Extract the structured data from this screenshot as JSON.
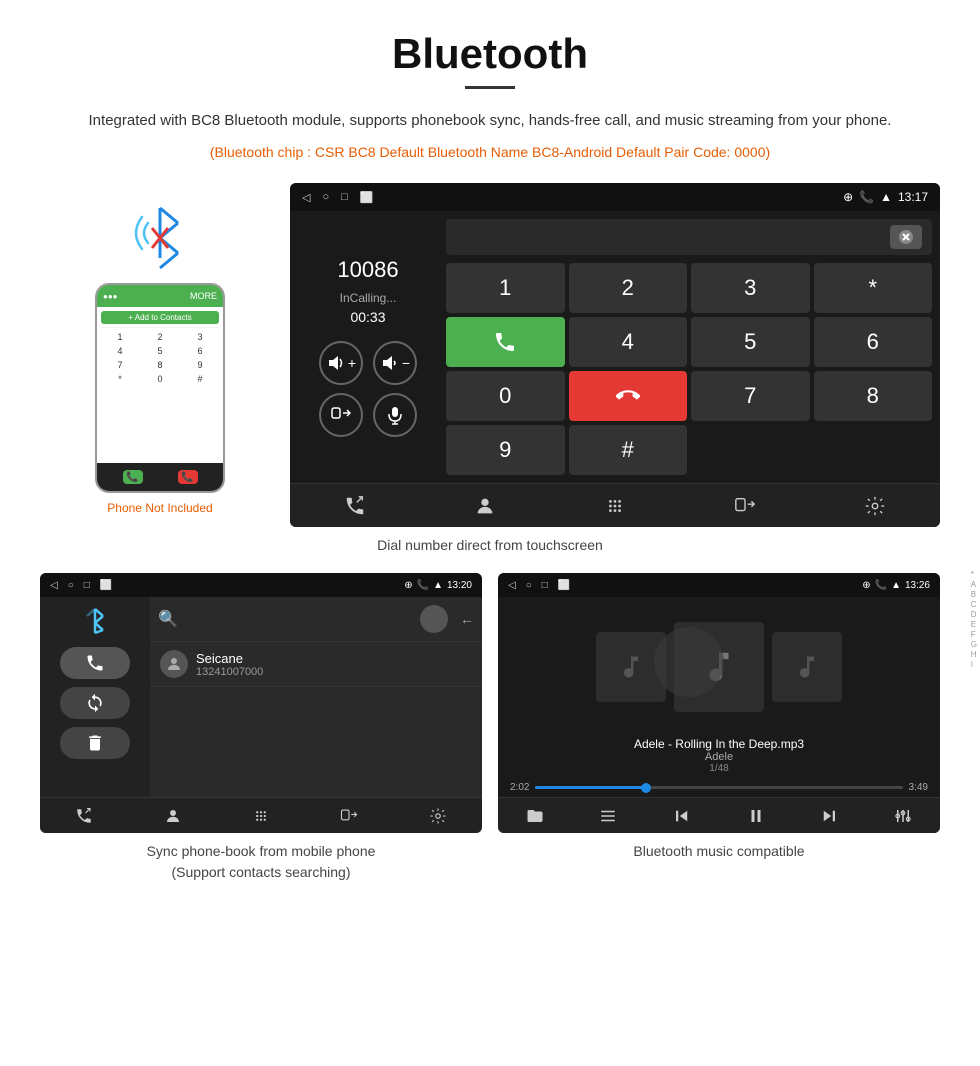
{
  "page": {
    "title": "Bluetooth",
    "description": "Integrated with BC8 Bluetooth module, supports phonebook sync, hands-free call, and music streaming from your phone.",
    "specs": "(Bluetooth chip : CSR BC8    Default Bluetooth Name BC8-Android    Default Pair Code: 0000)",
    "phone_not_included": "Phone Not Included",
    "dial_caption": "Dial number direct from touchscreen",
    "phonebook_caption_line1": "Sync phone-book from mobile phone",
    "phonebook_caption_line2": "(Support contacts searching)",
    "music_caption": "Bluetooth music compatible"
  },
  "dialer": {
    "number": "10086",
    "status": "InCalling...",
    "timer": "00:33",
    "time": "13:17"
  },
  "phonebook": {
    "contact_name": "Seicane",
    "contact_number": "13241007000",
    "time": "13:20",
    "alpha": [
      "*",
      "A",
      "B",
      "C",
      "D",
      "E",
      "F",
      "G",
      "H",
      "I"
    ]
  },
  "music": {
    "title": "Adele - Rolling In the Deep.mp3",
    "artist": "Adele",
    "track_info": "1/48",
    "current_time": "2:02",
    "total_time": "3:49",
    "progress": 30,
    "time": "13:26"
  },
  "keypad": {
    "keys": [
      "1",
      "2",
      "3",
      "*",
      "4",
      "5",
      "6",
      "0",
      "7",
      "8",
      "9",
      "#"
    ]
  }
}
